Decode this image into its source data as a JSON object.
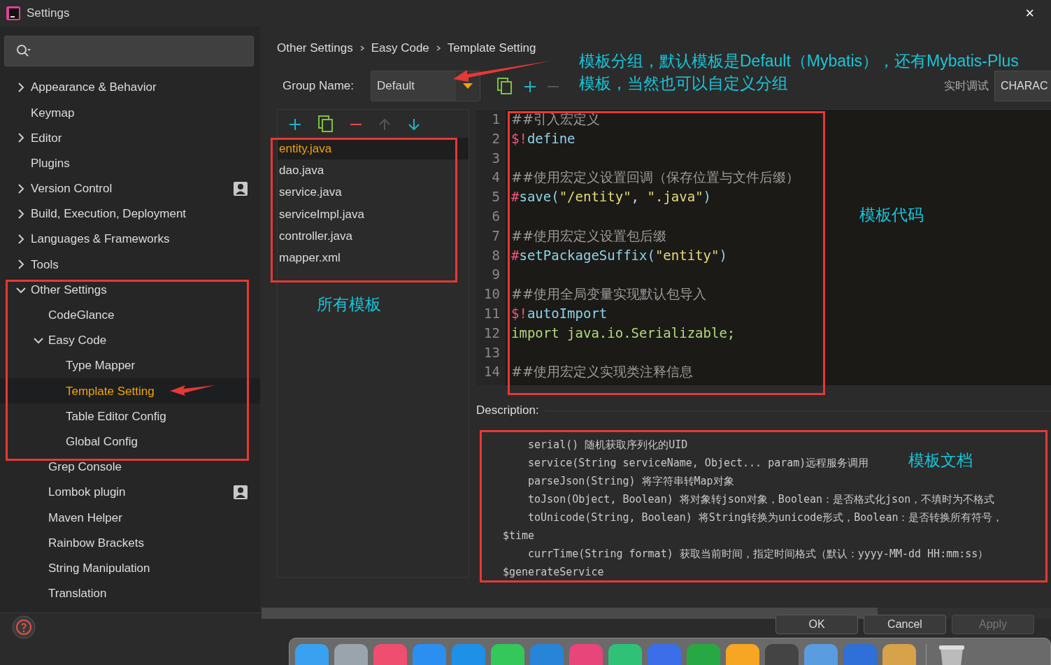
{
  "window": {
    "title": "Settings",
    "close": "×"
  },
  "sidebar": {
    "items": [
      {
        "label": "Appearance & Behavior",
        "expanded": false,
        "selected": false
      },
      {
        "label": "Keymap",
        "selected": false
      },
      {
        "label": "Editor",
        "expanded": false,
        "selected": false
      },
      {
        "label": "Plugins",
        "selected": false
      },
      {
        "label": "Version Control",
        "expanded": false,
        "selected": false,
        "project_badge": true
      },
      {
        "label": "Build, Execution, Deployment",
        "expanded": false,
        "selected": false
      },
      {
        "label": "Languages & Frameworks",
        "expanded": false,
        "selected": false
      },
      {
        "label": "Tools",
        "expanded": false,
        "selected": false
      },
      {
        "label": "Other Settings",
        "expanded": true,
        "selected": false,
        "children": [
          {
            "label": "CodeGlance",
            "selected": false
          },
          {
            "label": "Easy Code",
            "expanded": true,
            "selected": false,
            "children": [
              {
                "label": "Type Mapper",
                "selected": false
              },
              {
                "label": "Template Setting",
                "selected": true
              },
              {
                "label": "Table Editor Config",
                "selected": false
              },
              {
                "label": "Global Config",
                "selected": false
              }
            ]
          },
          {
            "label": "Grep Console",
            "selected": false
          },
          {
            "label": "Lombok plugin",
            "selected": false,
            "project_badge": true
          },
          {
            "label": "Maven Helper",
            "selected": false
          },
          {
            "label": "Rainbow Brackets",
            "selected": false
          },
          {
            "label": "String Manipulation",
            "selected": false
          },
          {
            "label": "Translation",
            "selected": false
          }
        ]
      }
    ]
  },
  "breadcrumb": [
    "Other Settings",
    "Easy Code",
    "Template Setting"
  ],
  "group": {
    "label": "Group Name:",
    "value": "Default",
    "debug_label": "实时调试",
    "charset_button": "CHARAC"
  },
  "templates": [
    {
      "name": "entity.java",
      "selected": true
    },
    {
      "name": "dao.java",
      "selected": false
    },
    {
      "name": "service.java",
      "selected": false
    },
    {
      "name": "serviceImpl.java",
      "selected": false
    },
    {
      "name": "controller.java",
      "selected": false
    },
    {
      "name": "mapper.xml",
      "selected": false
    }
  ],
  "editor": {
    "lines": [
      {
        "number": "1",
        "tokens": [
          {
            "text": "##引入宏定义",
            "kind": "comment"
          }
        ]
      },
      {
        "number": "2",
        "tokens": [
          {
            "text": "$!",
            "kind": "sigil"
          },
          {
            "text": "define",
            "kind": "macro"
          }
        ]
      },
      {
        "number": "3"
      },
      {
        "number": "4",
        "tokens": [
          {
            "text": "##使用宏定义设置回调（保存位置与文件后缀）",
            "kind": "comment"
          }
        ]
      },
      {
        "number": "5",
        "tokens": [
          {
            "text": "#",
            "kind": "sigil"
          },
          {
            "text": "save(",
            "kind": "macro"
          },
          {
            "text": "\"/entity\"",
            "kind": "string"
          },
          {
            "text": ", ",
            "kind": "plain"
          },
          {
            "text": "\".java\"",
            "kind": "string"
          },
          {
            "text": ")",
            "kind": "macro"
          }
        ]
      },
      {
        "number": "6"
      },
      {
        "number": "7",
        "tokens": [
          {
            "text": "##使用宏定义设置包后缀",
            "kind": "comment"
          }
        ]
      },
      {
        "number": "8",
        "tokens": [
          {
            "text": "#",
            "kind": "sigil"
          },
          {
            "text": "setPackageSuffix(",
            "kind": "macro"
          },
          {
            "text": "\"entity\"",
            "kind": "string"
          },
          {
            "text": ")",
            "kind": "macro"
          }
        ]
      },
      {
        "number": "9"
      },
      {
        "number": "10",
        "tokens": [
          {
            "text": "##使用全局变量实现默认包导入",
            "kind": "comment"
          }
        ]
      },
      {
        "number": "11",
        "tokens": [
          {
            "text": "$!",
            "kind": "sigil"
          },
          {
            "text": "autoImport",
            "kind": "macro"
          }
        ]
      },
      {
        "number": "12",
        "tokens": [
          {
            "text": "import java.io.Serializable;",
            "kind": "code"
          }
        ]
      },
      {
        "number": "13"
      },
      {
        "number": "14",
        "tokens": [
          {
            "text": "##使用宏定义实现类注释信息",
            "kind": "comment"
          }
        ]
      }
    ]
  },
  "description": {
    "label": "Description:",
    "lines": [
      {
        "text": "serial() 随机获取序列化的UID",
        "kind": "method"
      },
      {
        "text": "service(String serviceName, Object... param)远程服务调用",
        "kind": "method"
      },
      {
        "text": "parseJson(String) 将字符串转Map对象",
        "kind": "method"
      },
      {
        "text": "toJson(Object, Boolean) 将对象转json对象，Boolean：是否格式化json，不填时为不格式",
        "kind": "method"
      },
      {
        "text": "toUnicode(String, Boolean) 将String转换为unicode形式，Boolean：是否转换所有符号，",
        "kind": "method"
      },
      {
        "text": "$time",
        "kind": "variable"
      },
      {
        "text": "currTime(String format) 获取当前时间，指定时间格式（默认：yyyy-MM-dd HH:mm:ss）",
        "kind": "method"
      },
      {
        "text": "$generateService",
        "kind": "variable"
      }
    ]
  },
  "buttons": [
    {
      "label": "OK",
      "disabled": false
    },
    {
      "label": "Cancel",
      "disabled": false
    },
    {
      "label": "Apply",
      "disabled": true
    }
  ],
  "annotations": [
    {
      "text": "模板分组，默认模板是Default（Mybatis），还有Mybatis-Plus",
      "kind": "group"
    },
    {
      "text": "模板，当然也可以自定义分组",
      "kind": "group2"
    },
    {
      "text": "所有模板",
      "kind": "templates"
    },
    {
      "text": "模板代码",
      "kind": "code"
    },
    {
      "text": "模板文档",
      "kind": "doc"
    }
  ]
}
